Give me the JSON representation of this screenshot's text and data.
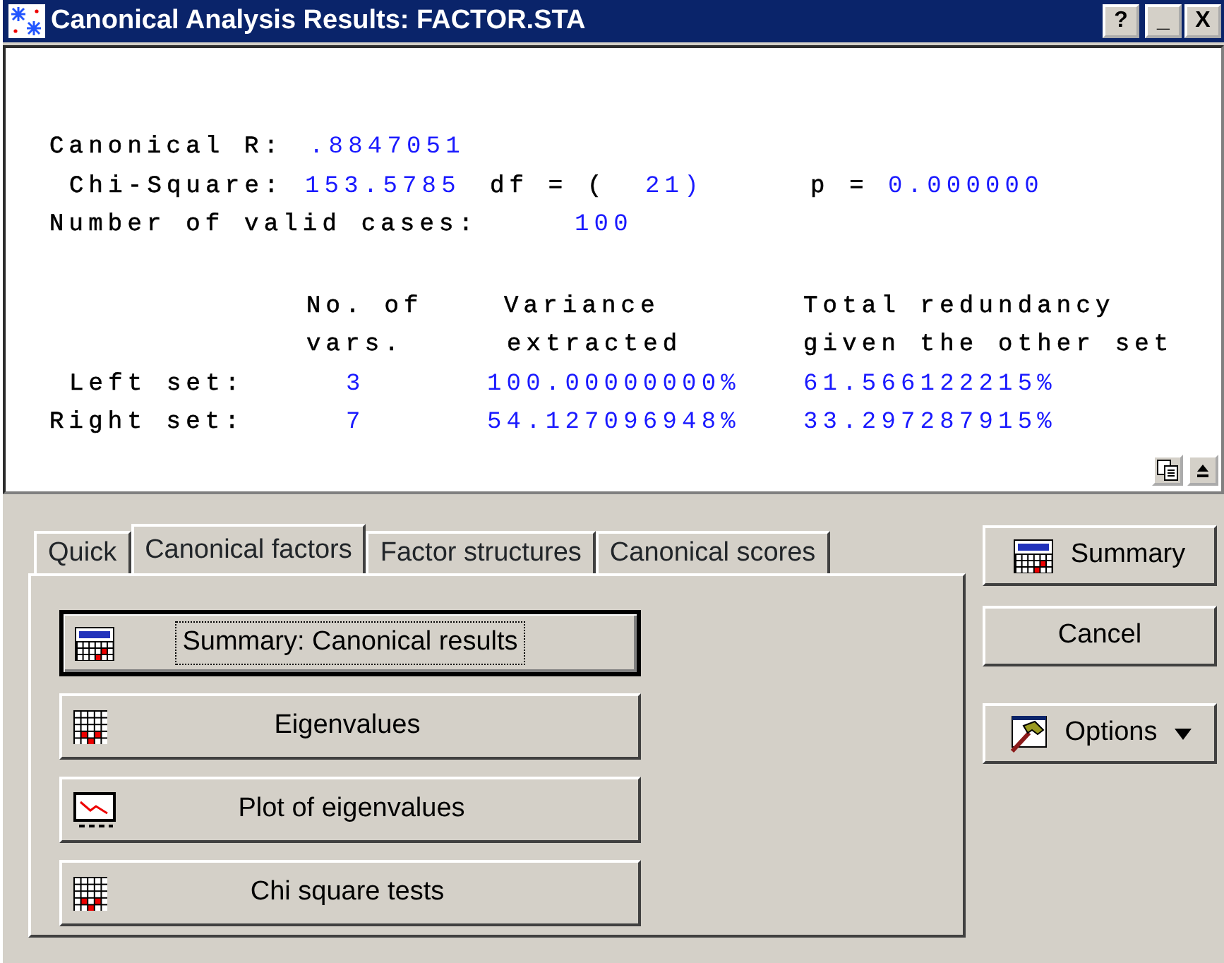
{
  "window": {
    "title": "Canonical Analysis Results: FACTOR.STA",
    "title_buttons": [
      "?",
      "_",
      "X"
    ]
  },
  "output": {
    "lines": [
      {
        "segments": [
          {
            "text": "Canonical R:",
            "kind": "label"
          },
          {
            "text": ".8847051",
            "kind": "value"
          }
        ]
      },
      {
        "segments": [
          {
            "text": "Chi-Square:",
            "kind": "label"
          },
          {
            "text": "153.5785",
            "kind": "value"
          },
          {
            "text": "df = (",
            "kind": "label"
          },
          {
            "text": "21)",
            "kind": "value"
          },
          {
            "text": "p =",
            "kind": "label"
          },
          {
            "text": "0.000000",
            "kind": "value"
          }
        ]
      },
      {
        "segments": [
          {
            "text": "Number of valid cases:",
            "kind": "label"
          },
          {
            "text": "100",
            "kind": "value"
          }
        ]
      },
      {
        "segments": [
          {
            "text": "No. of",
            "kind": "label"
          },
          {
            "text": "Variance",
            "kind": "label"
          },
          {
            "text": "Total redundancy",
            "kind": "label"
          }
        ]
      },
      {
        "segments": [
          {
            "text": "vars.",
            "kind": "label"
          },
          {
            "text": "extracted",
            "kind": "label"
          },
          {
            "text": "given the other set",
            "kind": "label"
          }
        ]
      },
      {
        "segments": [
          {
            "text": "Left set:",
            "kind": "label"
          },
          {
            "text": "3",
            "kind": "value"
          },
          {
            "text": "100.00000000%",
            "kind": "value"
          },
          {
            "text": "61.566122215%",
            "kind": "value"
          }
        ]
      },
      {
        "segments": [
          {
            "text": "Right set:",
            "kind": "label"
          },
          {
            "text": "7",
            "kind": "value"
          },
          {
            "text": "54.127096948%",
            "kind": "value"
          },
          {
            "text": "33.297287915%",
            "kind": "value"
          }
        ]
      }
    ]
  },
  "tabs": [
    {
      "label": "Quick",
      "selected": false
    },
    {
      "label": "Canonical factors",
      "selected": true
    },
    {
      "label": "Factor structures",
      "selected": false
    },
    {
      "label": "Canonical scores",
      "selected": false
    }
  ],
  "actions": [
    {
      "label": "Summary:  Canonical results",
      "focused": true
    },
    {
      "label": "Eigenvalues",
      "focused": false
    },
    {
      "label": "Plot of eigenvalues",
      "focused": false
    },
    {
      "label": "Chi square tests",
      "focused": false
    }
  ],
  "side_buttons": [
    {
      "label": "Summary",
      "dropdown": false
    },
    {
      "label": "Cancel",
      "dropdown": false
    },
    {
      "label": "Options",
      "dropdown": true
    }
  ]
}
